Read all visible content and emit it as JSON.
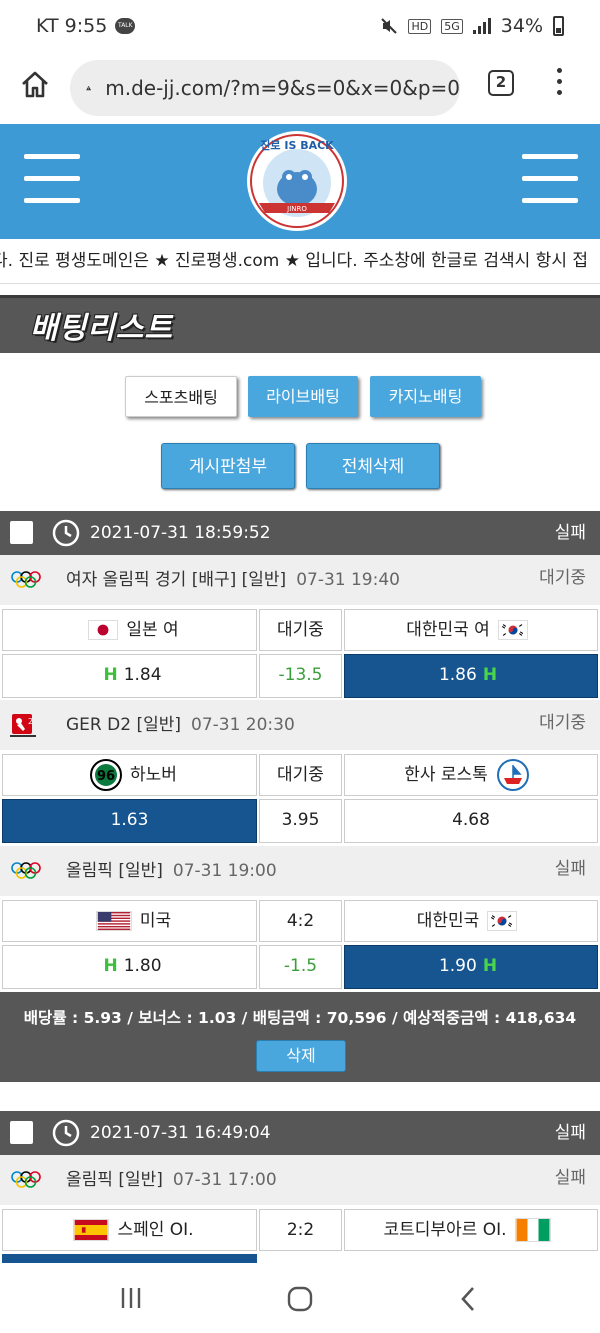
{
  "statusbar": {
    "carrier_time": "KT 9:55",
    "talk": "TALK",
    "hd": "HD",
    "net": "5G",
    "battery": "34%"
  },
  "browser": {
    "url": "m.de-jj.com/?m=9&s=0&x=0&p=0",
    "tab_count": "2"
  },
  "header": {
    "logo_text": "진로 IS BACK",
    "logo_sub": "JINRO"
  },
  "ticker": "다. 진로 평생도메인은 ★ 진로평생.com ★ 입니다. 주소창에 한글로 검색시 항시 접",
  "page_title": "배팅리스트",
  "category_tabs": [
    "스포츠배팅",
    "라이브배팅",
    "카지노배팅"
  ],
  "actions": {
    "attach": "게시판첨부",
    "delete_all": "전체삭제"
  },
  "slips": [
    {
      "datetime": "2021-07-31 18:59:52",
      "result": "실패",
      "games": [
        {
          "league": "여자 올림픽 경기 [배구] [일반]",
          "time": "07-31 19:40",
          "status": "대기중",
          "icon": "olympic-icon",
          "home": "일본 여",
          "home_flag": "flag-japan-icon",
          "mid": "대기중",
          "away": "대한민국 여",
          "away_flag": "flag-korea-icon",
          "home_odds": "1.84",
          "handicap": "-13.5",
          "away_odds": "1.86",
          "selected": "away",
          "type": "handicap"
        },
        {
          "league": "GER D2 [일반]",
          "time": "07-31 20:30",
          "status": "대기중",
          "icon": "bundesliga2-icon",
          "home": "하노버",
          "home_flag": "hannover96-logo-icon",
          "mid": "대기중",
          "away": "한사 로스톡",
          "away_flag": "hansa-rostock-logo-icon",
          "home_odds": "1.63",
          "handicap": "3.95",
          "away_odds": "4.68",
          "selected": "home",
          "type": "1x2"
        },
        {
          "league": "올림픽 [일반]",
          "time": "07-31 19:00",
          "status": "실패",
          "icon": "olympic-icon",
          "home": "미국",
          "home_flag": "flag-usa-icon",
          "mid": "4:2",
          "away": "대한민국",
          "away_flag": "flag-korea-icon",
          "home_odds": "1.80",
          "handicap": "-1.5",
          "away_odds": "1.90",
          "selected": "away",
          "type": "handicap"
        }
      ],
      "summary": "배당률 : 5.93 / 보너스 : 1.03 / 배팅금액 : 70,596 / 예상적중금액 : 418,634",
      "delete_label": "삭제"
    },
    {
      "datetime": "2021-07-31 16:49:04",
      "result": "실패",
      "games": [
        {
          "league": "올림픽 [일반]",
          "time": "07-31 17:00",
          "status": "실패",
          "icon": "olympic-icon",
          "home": "스페인 OI.",
          "home_flag": "flag-spain-icon",
          "mid": "2:2",
          "away": "코트디부아르 OI.",
          "away_flag": "flag-ivory-coast-icon"
        }
      ]
    }
  ]
}
